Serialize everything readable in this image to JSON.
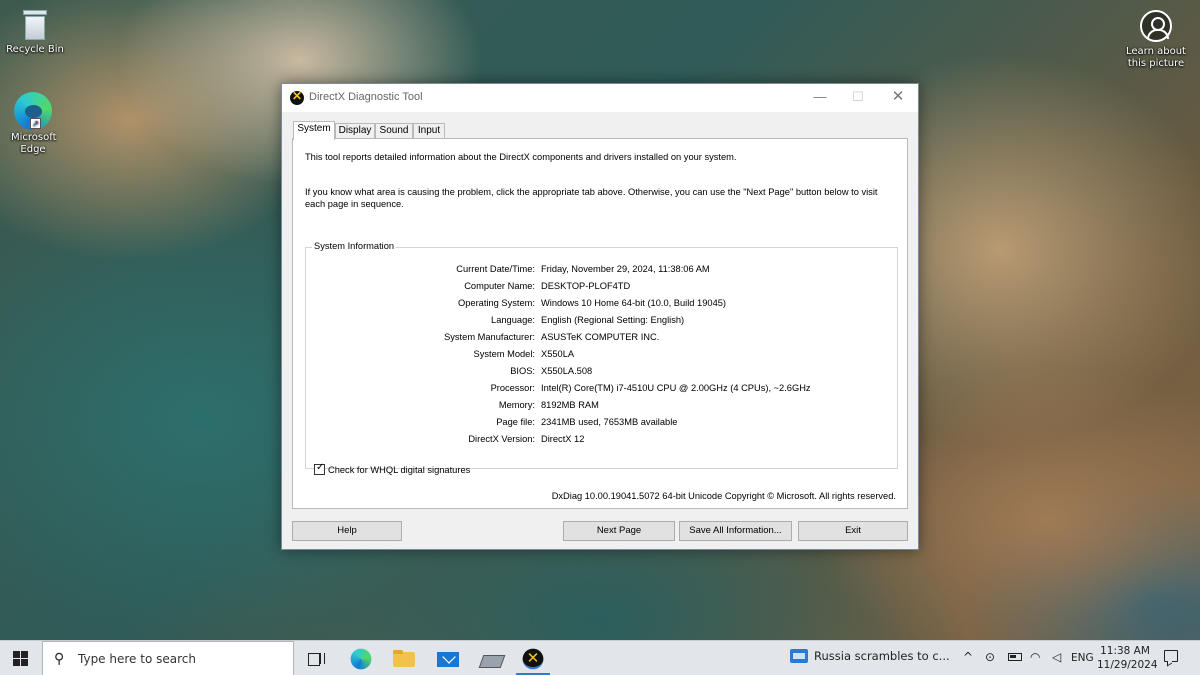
{
  "desktop": {
    "icons": [
      {
        "label": "Recycle Bin",
        "icon": "recycle-bin-icon"
      },
      {
        "label": "Microsoft Edge",
        "icon": "edge-icon"
      }
    ],
    "spotlight": {
      "label": "Learn about this picture",
      "icon": "camera-info-icon"
    }
  },
  "window": {
    "title": "DirectX Diagnostic Tool",
    "controls": {
      "minimize": "—",
      "maximize": "☐",
      "close": "✕"
    },
    "tabs": [
      "System",
      "Display",
      "Sound",
      "Input"
    ],
    "active_tab": "System",
    "intro_1": "This tool reports detailed information about the DirectX components and drivers installed on your system.",
    "intro_2": "If you know what area is causing the problem, click the appropriate tab above.  Otherwise, you can use the \"Next Page\" button below to visit each page in sequence.",
    "group_title": "System Information",
    "rows": [
      {
        "label": "Current Date/Time:",
        "value": "Friday, November 29, 2024, 11:38:06 AM"
      },
      {
        "label": "Computer Name:",
        "value": "DESKTOP-PLOF4TD"
      },
      {
        "label": "Operating System:",
        "value": "Windows 10 Home 64-bit (10.0, Build 19045)"
      },
      {
        "label": "Language:",
        "value": "English (Regional Setting: English)"
      },
      {
        "label": "System Manufacturer:",
        "value": "ASUSTeK COMPUTER INC."
      },
      {
        "label": "System Model:",
        "value": "X550LA"
      },
      {
        "label": "BIOS:",
        "value": "X550LA.508"
      },
      {
        "label": "Processor:",
        "value": "Intel(R) Core(TM) i7-4510U CPU @ 2.00GHz (4 CPUs), ~2.6GHz"
      },
      {
        "label": "Memory:",
        "value": "8192MB RAM"
      },
      {
        "label": "Page file:",
        "value": "2341MB used, 7653MB available"
      },
      {
        "label": "DirectX Version:",
        "value": "DirectX 12"
      }
    ],
    "whql_label": "Check for WHQL digital signatures",
    "whql_checked": true,
    "copyright": "DxDiag 10.00.19041.5072 64-bit Unicode  Copyright © Microsoft. All rights reserved.",
    "buttons": {
      "help": "Help",
      "next_page": "Next Page",
      "save_all": "Save All Information...",
      "exit": "Exit"
    }
  },
  "taskbar": {
    "search_placeholder": "Type here to search",
    "pinned": [
      "task-view-icon",
      "edge-icon",
      "file-explorer-icon",
      "mail-icon",
      "installer-icon",
      "directx-icon"
    ],
    "news": "Russia scrambles to c...",
    "tray_chevron": "^",
    "language": "ENG",
    "time": "11:38 AM",
    "date": "11/29/2024"
  },
  "colors": {
    "accent": "#3a78c8",
    "taskbar": "#e2e6ea",
    "dialog_bg": "#f0f0f0"
  }
}
